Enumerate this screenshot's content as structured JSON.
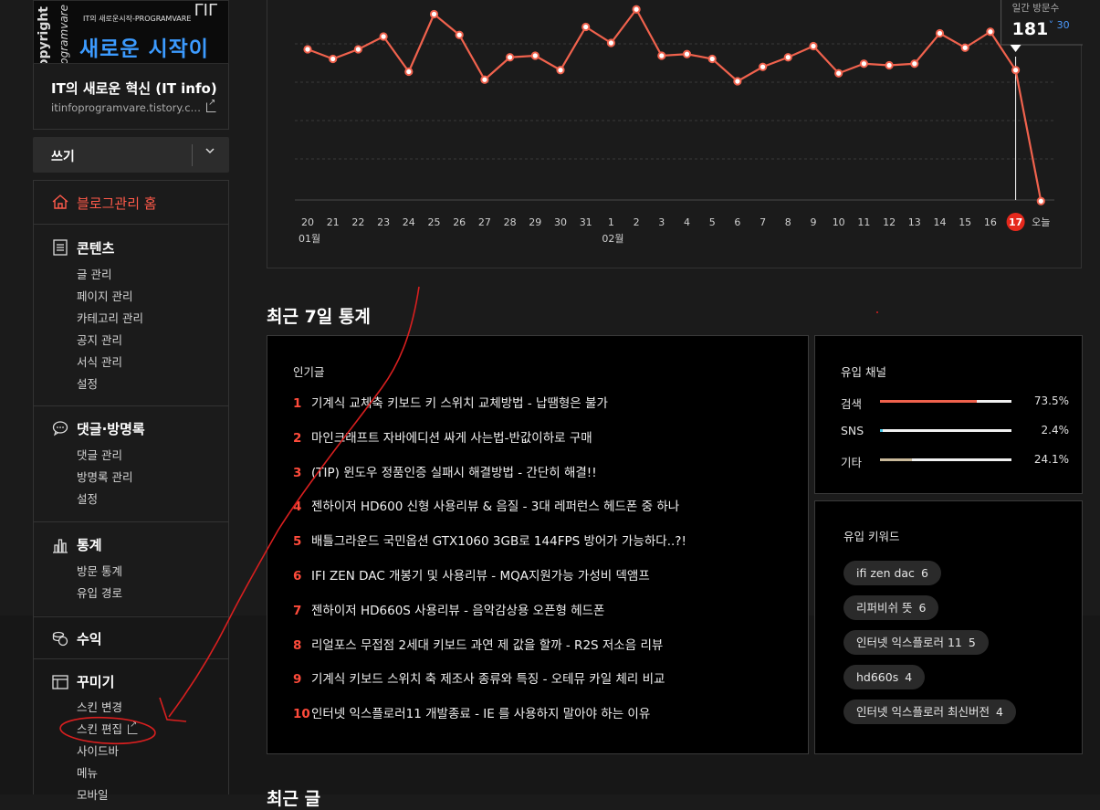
{
  "blog": {
    "thumb_vertical_1": "copyright",
    "thumb_vertical_2": "programvare",
    "thumb_small": "IT의 새로운시작-PROGRAMVARE",
    "thumb_tag": "ΓΙΓ",
    "thumb_title": "새로운 시작이다",
    "name": "IT의 새로운 혁신 (IT info)",
    "url": "itinfoprogramvare.tistory.c…"
  },
  "write": {
    "label": "쓰기"
  },
  "nav": {
    "home": "블로그관리 홈",
    "sections": [
      {
        "title": "콘텐츠",
        "items": [
          "글 관리",
          "페이지 관리",
          "카테고리 관리",
          "공지 관리",
          "서식 관리",
          "설정"
        ]
      },
      {
        "title": "댓글·방명록",
        "items": [
          "댓글 관리",
          "방명록 관리",
          "설정"
        ]
      },
      {
        "title": "통계",
        "items": [
          "방문 통계",
          "유입 경로"
        ]
      },
      {
        "title": "수익",
        "items": []
      },
      {
        "title": "꾸미기",
        "items": [
          "스킨 변경",
          "스킨 편집",
          "사이드바",
          "메뉴",
          "모바일"
        ]
      }
    ]
  },
  "chart_data": {
    "type": "line",
    "x_labels": [
      "20",
      "21",
      "22",
      "23",
      "24",
      "25",
      "26",
      "27",
      "28",
      "29",
      "30",
      "31",
      "1",
      "2",
      "3",
      "4",
      "5",
      "6",
      "7",
      "8",
      "9",
      "10",
      "11",
      "12",
      "13",
      "14",
      "15",
      "16",
      "17",
      "오늘"
    ],
    "month_labels": [
      {
        "label": "01월",
        "at": "20"
      },
      {
        "label": "02월",
        "at": "1"
      }
    ],
    "values": [
      194,
      188,
      194,
      202,
      180,
      216,
      203,
      175,
      189,
      190,
      181,
      208,
      198,
      219,
      190,
      191,
      188,
      174,
      183,
      189,
      196,
      179,
      185,
      184,
      185,
      204,
      195,
      205,
      181,
      99
    ],
    "highlight_index": 28,
    "tooltip": {
      "label": "일간 방문수",
      "value": "181",
      "delta": "30",
      "delta_direction": "down"
    },
    "colors": {
      "line": "#f0624d",
      "highlight": "#e5281c",
      "grid": "#3a3a3a",
      "delta": "#4c9bff"
    }
  },
  "recent": {
    "title": "최근 7일 통계",
    "popular_label": "인기글",
    "popular": [
      "기계식 교체축 키보드 키 스위치 교체방법 - 납땜형은 불가",
      "마인크래프트 자바에디션 싸게 사는법-반값이하로 구매",
      "(TIP) 윈도우 정품인증 실패시 해결방법 - 간단히 해결!!",
      "젠하이저 HD600 신형 사용리뷰 & 음질 - 3대 레퍼런스 헤드폰 중 하나",
      "배틀그라운드 국민옵션 GTX1060 3GB로 144FPS 방어가 가능하다..?!",
      "IFI ZEN DAC 개봉기 및 사용리뷰 - MQA지원가능 가성비 덱앰프",
      "젠하이저 HD660S 사용리뷰 - 음악감상용 오픈형 헤드폰",
      "리얼포스 무접점 2세대 키보드 과연 제 값을 할까 - R2S 저소음 리뷰",
      "기계식 키보드 스위치 축 제조사 종류와 특징 - 오테뮤 카일 체리 비교",
      "인터넷 익스플로러11 개발종료 - IE 를 사용하지 말아야 하는 이유"
    ],
    "channel_label": "유입 채널",
    "channels": [
      {
        "name": "검색",
        "pct": 73.5,
        "pct_text": "73.5%",
        "color": "#f0624d"
      },
      {
        "name": "SNS",
        "pct": 2.4,
        "pct_text": "2.4%",
        "color": "#46c6e6"
      },
      {
        "name": "기타",
        "pct": 24.1,
        "pct_text": "24.1%",
        "color": "#c9b99a"
      }
    ],
    "keyword_label": "유입 키워드",
    "keywords": [
      {
        "text": "ifi zen dac",
        "count": "6"
      },
      {
        "text": "리퍼비쉬 뜻",
        "count": "6"
      },
      {
        "text": "인터넷 익스플로러 11",
        "count": "5"
      },
      {
        "text": "hd660s",
        "count": "4"
      },
      {
        "text": "인터넷 익스플로러 최신버전",
        "count": "4"
      }
    ]
  },
  "bottom_peek": "최근 글"
}
